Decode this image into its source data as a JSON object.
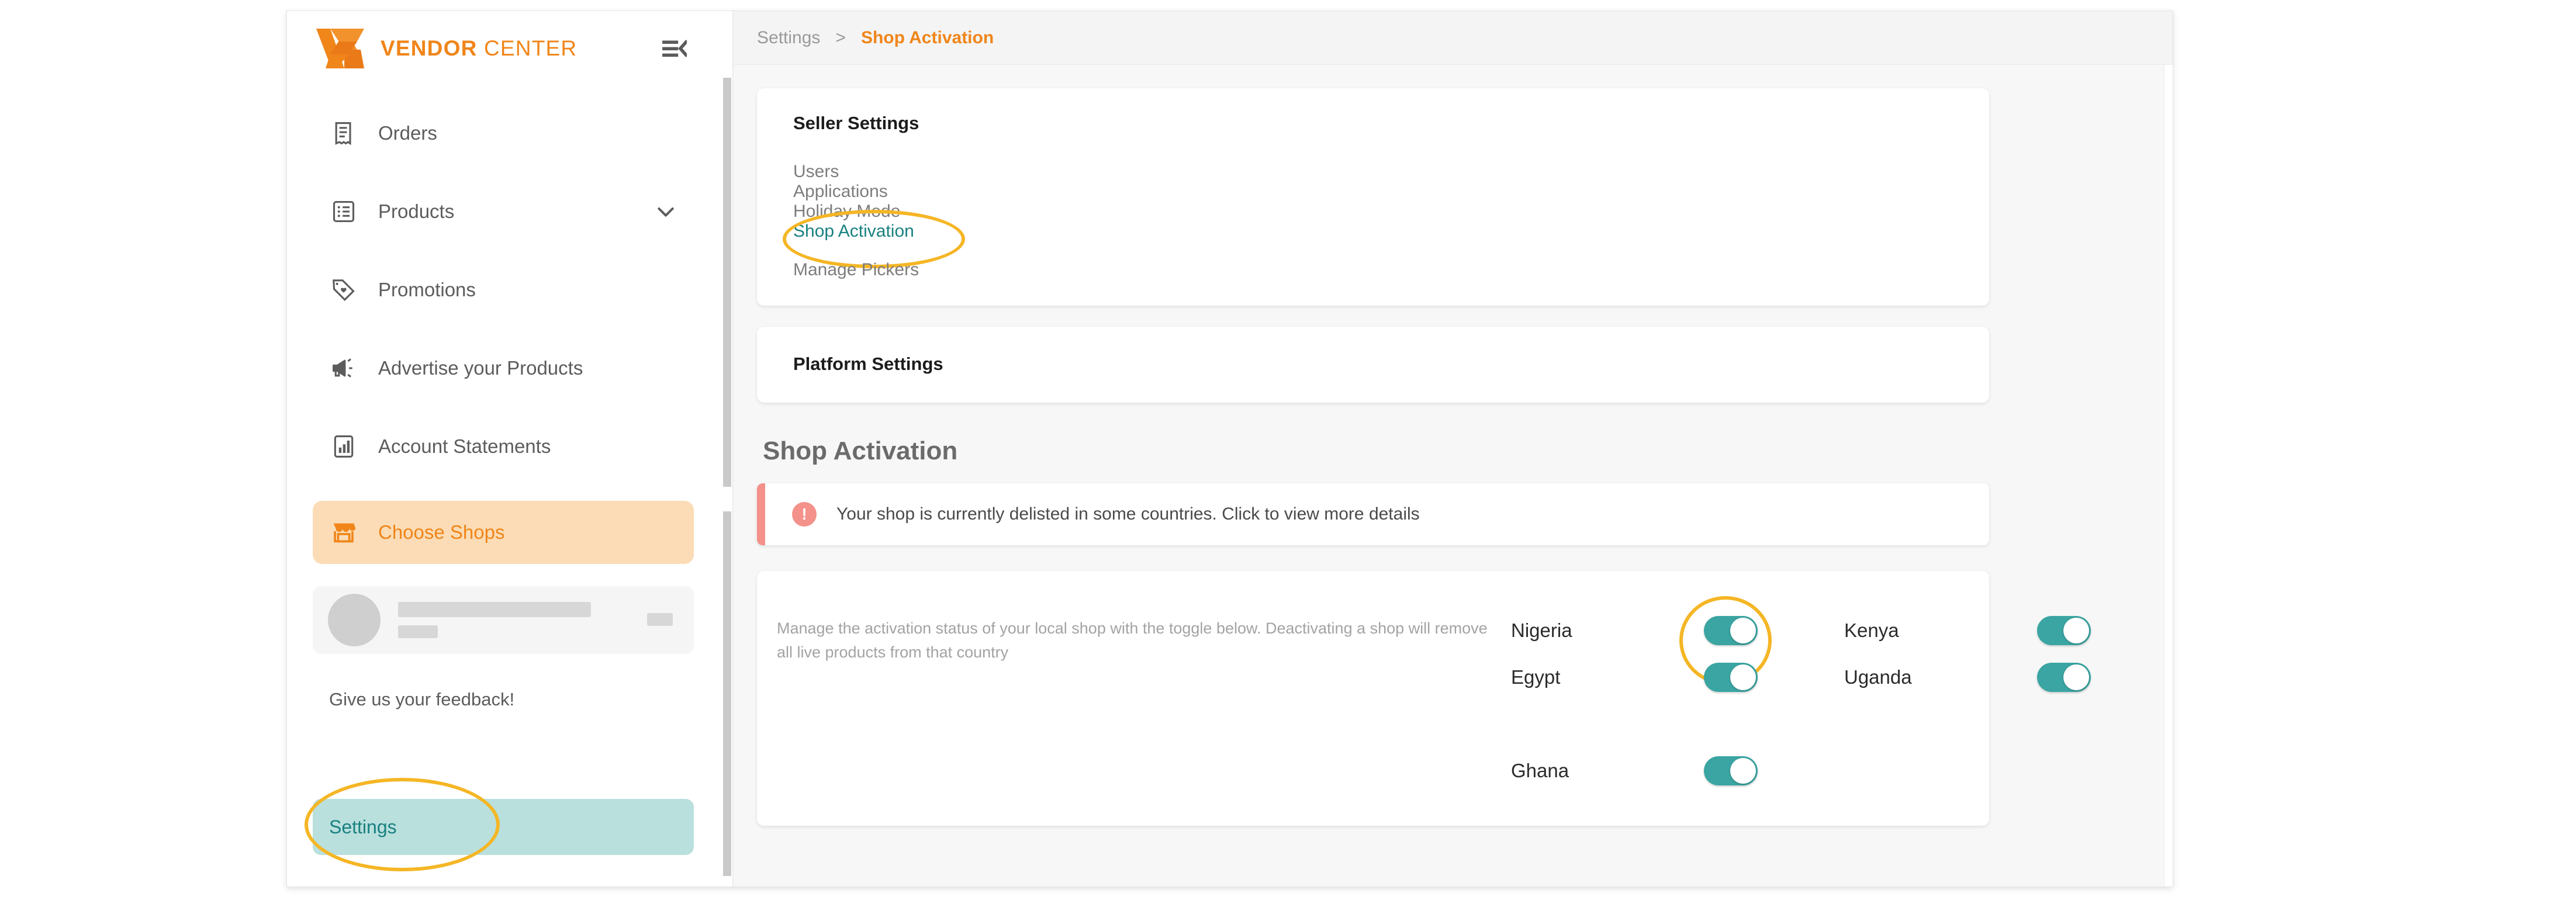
{
  "brand": {
    "name_bold": "VENDOR",
    "name_light": "CENTER",
    "logo_icon": "vc-logo-icon",
    "collapse_icon": "menu-collapse-icon"
  },
  "sidebar": {
    "items": [
      {
        "label": "Orders",
        "icon": "receipt-icon",
        "has_chevron": false
      },
      {
        "label": "Products",
        "icon": "list-icon",
        "has_chevron": true
      },
      {
        "label": "Promotions",
        "icon": "tag-heart-icon",
        "has_chevron": false
      },
      {
        "label": "Advertise your Products",
        "icon": "megaphone-icon",
        "has_chevron": false
      },
      {
        "label": "Account Statements",
        "icon": "bar-chart-icon",
        "has_chevron": false
      }
    ],
    "choose_shops": {
      "label": "Choose Shops",
      "icon": "storefront-icon"
    },
    "profile": {
      "redacted": true,
      "avatar_icon": "avatar-icon"
    },
    "feedback_label": "Give us your feedback!",
    "settings_label": "Settings"
  },
  "breadcrumb": {
    "parent": "Settings",
    "separator": ">",
    "current": "Shop Activation"
  },
  "seller_settings": {
    "title": "Seller Settings",
    "links": [
      {
        "label": "Users",
        "active": false
      },
      {
        "label": "Applications",
        "active": false
      },
      {
        "label": "Holiday Mode",
        "active": false
      },
      {
        "label": "Shop Activation",
        "active": true
      },
      {
        "label": "Manage Pickers",
        "active": false
      }
    ]
  },
  "platform_settings": {
    "title": "Platform Settings"
  },
  "shop_activation": {
    "page_title": "Shop Activation",
    "alert": {
      "icon": "exclamation-circle-icon",
      "text": "Your shop is currently delisted in some countries. Click to view more details",
      "accent_color": "#f4918b"
    },
    "description": "Manage the activation status of your local shop with the toggle below. Deactivating a shop will remove all live products from that country",
    "countries": [
      {
        "name": "Nigeria",
        "enabled": true,
        "highlighted": true
      },
      {
        "name": "Kenya",
        "enabled": true,
        "highlighted": false
      },
      {
        "name": "Egypt",
        "enabled": true,
        "highlighted": false
      },
      {
        "name": "Uganda",
        "enabled": true,
        "highlighted": false
      },
      {
        "name": "Ghana",
        "enabled": true,
        "highlighted": false
      }
    ]
  },
  "colors": {
    "brand_orange": "#f08519",
    "shops_bg": "#fbdcb6",
    "teal": "#3aa5a2",
    "teal_text": "#1a8080",
    "settings_bg": "#b9e0dd",
    "annotation_yellow": "#f5b625",
    "alert_coral": "#f4918b"
  }
}
